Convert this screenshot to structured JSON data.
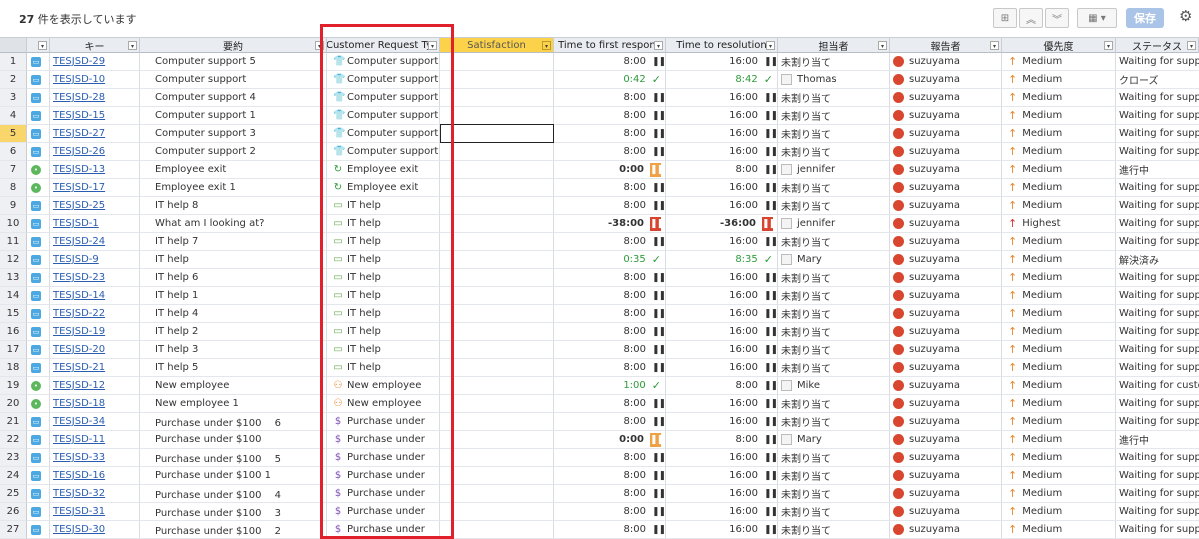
{
  "toolbar": {
    "count_number": "27",
    "count_suffix": " 件を表示しています",
    "save_label": "保存",
    "hierarchy_icon": "hierarchy-icon",
    "columns_icon": "columns-icon"
  },
  "columns": [
    {
      "label": "",
      "name": "col-rownum"
    },
    {
      "label": "",
      "name": "col-type"
    },
    {
      "label": "キー",
      "name": "col-key"
    },
    {
      "label": "要約",
      "name": "col-summary"
    },
    {
      "label": "Customer Request Ty",
      "name": "col-request-type"
    },
    {
      "label": "Satisfaction",
      "name": "col-satisfaction"
    },
    {
      "label": "Time to first respons",
      "name": "col-first-response"
    },
    {
      "label": "Time to resolution",
      "name": "col-resolution"
    },
    {
      "label": "担当者",
      "name": "col-assignee"
    },
    {
      "label": "報告者",
      "name": "col-reporter"
    },
    {
      "label": "優先度",
      "name": "col-priority"
    },
    {
      "label": "ステータス",
      "name": "col-status"
    }
  ],
  "rows": [
    {
      "n": "1",
      "t": "blue",
      "key": "TESJSD-29",
      "summary": "Computer support 5",
      "rtype": "Computer support",
      "ri": "shirt",
      "sat": "",
      "fr": "8:00",
      "frs": "pause",
      "res": "16:00",
      "ress": "pause",
      "asg": "未割り当て",
      "av": "none",
      "rep": "suzuyama",
      "pri": "Medium",
      "pa": "orange",
      "status": "Waiting for suppo"
    },
    {
      "n": "2",
      "t": "blue",
      "key": "TESJSD-10",
      "summary": "Computer support",
      "rtype": "Computer support",
      "ri": "shirt",
      "sat": "",
      "fr": "0:42",
      "frs": "check",
      "res": "8:42",
      "ress": "check",
      "asg": "Thomas",
      "av": "gray",
      "rep": "suzuyama",
      "pri": "Medium",
      "pa": "orange",
      "status": "クローズ"
    },
    {
      "n": "3",
      "t": "blue",
      "key": "TESJSD-28",
      "summary": "Computer support 4",
      "rtype": "Computer support",
      "ri": "shirt",
      "sat": "",
      "fr": "8:00",
      "frs": "pause",
      "res": "16:00",
      "ress": "pause",
      "asg": "未割り当て",
      "av": "none",
      "rep": "suzuyama",
      "pri": "Medium",
      "pa": "orange",
      "status": "Waiting for suppo"
    },
    {
      "n": "4",
      "t": "blue",
      "key": "TESJSD-15",
      "summary": "Computer support 1",
      "rtype": "Computer support",
      "ri": "shirt",
      "sat": "",
      "fr": "8:00",
      "frs": "pause",
      "res": "16:00",
      "ress": "pause",
      "asg": "未割り当て",
      "av": "none",
      "rep": "suzuyama",
      "pri": "Medium",
      "pa": "orange",
      "status": "Waiting for suppo"
    },
    {
      "n": "5",
      "t": "blue",
      "key": "TESJSD-27",
      "summary": "Computer support 3",
      "rtype": "Computer support",
      "ri": "shirt",
      "sat": "",
      "fr": "8:00",
      "frs": "pause",
      "res": "16:00",
      "ress": "pause",
      "asg": "未割り当て",
      "av": "none",
      "rep": "suzuyama",
      "pri": "Medium",
      "pa": "orange",
      "status": "Waiting for suppo"
    },
    {
      "n": "6",
      "t": "blue",
      "key": "TESJSD-26",
      "summary": "Computer support 2",
      "rtype": "Computer support",
      "ri": "shirt",
      "sat": "",
      "fr": "8:00",
      "frs": "pause",
      "res": "16:00",
      "ress": "pause",
      "asg": "未割り当て",
      "av": "none",
      "rep": "suzuyama",
      "pri": "Medium",
      "pa": "orange",
      "status": "Waiting for suppo"
    },
    {
      "n": "7",
      "t": "green",
      "key": "TESJSD-13",
      "summary": "Employee exit",
      "rtype": "Employee exit",
      "ri": "cycle",
      "sat": "",
      "fr": "0:00",
      "frs": "orange",
      "res": "8:00",
      "ress": "pause",
      "asg": "jennifer",
      "av": "gray",
      "rep": "suzuyama",
      "pri": "Medium",
      "pa": "orange",
      "status": "進行中"
    },
    {
      "n": "8",
      "t": "green",
      "key": "TESJSD-17",
      "summary": "Employee exit 1",
      "rtype": "Employee exit",
      "ri": "cycle",
      "sat": "",
      "fr": "8:00",
      "frs": "pause",
      "res": "16:00",
      "ress": "pause",
      "asg": "未割り当て",
      "av": "none",
      "rep": "suzuyama",
      "pri": "Medium",
      "pa": "orange",
      "status": "Waiting for suppo"
    },
    {
      "n": "9",
      "t": "blue",
      "key": "TESJSD-25",
      "summary": "IT help 8",
      "rtype": "IT help",
      "ri": "it",
      "sat": "",
      "fr": "8:00",
      "frs": "pause",
      "res": "16:00",
      "ress": "pause",
      "asg": "未割り当て",
      "av": "none",
      "rep": "suzuyama",
      "pri": "Medium",
      "pa": "orange",
      "status": "Waiting for suppo"
    },
    {
      "n": "10",
      "t": "blue",
      "key": "TESJSD-1",
      "summary": "What am I looking at?",
      "rtype": "IT help",
      "ri": "it",
      "sat": "",
      "fr": "-38:00",
      "frs": "red",
      "res": "-36:00",
      "ress": "red",
      "asg": "jennifer",
      "av": "gray",
      "rep": "suzuyama",
      "pri": "Highest",
      "pa": "red",
      "status": "Waiting for suppo"
    },
    {
      "n": "11",
      "t": "blue",
      "key": "TESJSD-24",
      "summary": "IT help 7",
      "rtype": "IT help",
      "ri": "it",
      "sat": "",
      "fr": "8:00",
      "frs": "pause",
      "res": "16:00",
      "ress": "pause",
      "asg": "未割り当て",
      "av": "none",
      "rep": "suzuyama",
      "pri": "Medium",
      "pa": "orange",
      "status": "Waiting for suppo"
    },
    {
      "n": "12",
      "t": "blue",
      "key": "TESJSD-9",
      "summary": "IT help",
      "rtype": "IT help",
      "ri": "it",
      "sat": "",
      "fr": "0:35",
      "frs": "check",
      "res": "8:35",
      "ress": "check",
      "asg": "Mary",
      "av": "gray",
      "rep": "suzuyama",
      "pri": "Medium",
      "pa": "orange",
      "status": "解決済み"
    },
    {
      "n": "13",
      "t": "blue",
      "key": "TESJSD-23",
      "summary": "IT help 6",
      "rtype": "IT help",
      "ri": "it",
      "sat": "",
      "fr": "8:00",
      "frs": "pause",
      "res": "16:00",
      "ress": "pause",
      "asg": "未割り当て",
      "av": "none",
      "rep": "suzuyama",
      "pri": "Medium",
      "pa": "orange",
      "status": "Waiting for suppo"
    },
    {
      "n": "14",
      "t": "blue",
      "key": "TESJSD-14",
      "summary": "IT help 1",
      "rtype": "IT help",
      "ri": "it",
      "sat": "",
      "fr": "8:00",
      "frs": "pause",
      "res": "16:00",
      "ress": "pause",
      "asg": "未割り当て",
      "av": "none",
      "rep": "suzuyama",
      "pri": "Medium",
      "pa": "orange",
      "status": "Waiting for suppo"
    },
    {
      "n": "15",
      "t": "blue",
      "key": "TESJSD-22",
      "summary": "IT help 4",
      "rtype": "IT help",
      "ri": "it",
      "sat": "",
      "fr": "8:00",
      "frs": "pause",
      "res": "16:00",
      "ress": "pause",
      "asg": "未割り当て",
      "av": "none",
      "rep": "suzuyama",
      "pri": "Medium",
      "pa": "orange",
      "status": "Waiting for suppo"
    },
    {
      "n": "16",
      "t": "blue",
      "key": "TESJSD-19",
      "summary": "IT help 2",
      "rtype": "IT help",
      "ri": "it",
      "sat": "",
      "fr": "8:00",
      "frs": "pause",
      "res": "16:00",
      "ress": "pause",
      "asg": "未割り当て",
      "av": "none",
      "rep": "suzuyama",
      "pri": "Medium",
      "pa": "orange",
      "status": "Waiting for suppo"
    },
    {
      "n": "17",
      "t": "blue",
      "key": "TESJSD-20",
      "summary": "IT help 3",
      "rtype": "IT help",
      "ri": "it",
      "sat": "",
      "fr": "8:00",
      "frs": "pause",
      "res": "16:00",
      "ress": "pause",
      "asg": "未割り当て",
      "av": "none",
      "rep": "suzuyama",
      "pri": "Medium",
      "pa": "orange",
      "status": "Waiting for suppo"
    },
    {
      "n": "18",
      "t": "blue",
      "key": "TESJSD-21",
      "summary": "IT help 5",
      "rtype": "IT help",
      "ri": "it",
      "sat": "",
      "fr": "8:00",
      "frs": "pause",
      "res": "16:00",
      "ress": "pause",
      "asg": "未割り当て",
      "av": "none",
      "rep": "suzuyama",
      "pri": "Medium",
      "pa": "orange",
      "status": "Waiting for suppo"
    },
    {
      "n": "19",
      "t": "green",
      "key": "TESJSD-12",
      "summary": "New employee",
      "rtype": "New employee",
      "ri": "person",
      "sat": "",
      "fr": "1:00",
      "frs": "check",
      "res": "8:00",
      "ress": "pause",
      "asg": "Mike",
      "av": "gray",
      "rep": "suzuyama",
      "pri": "Medium",
      "pa": "orange",
      "status": "Waiting for custo"
    },
    {
      "n": "20",
      "t": "green",
      "key": "TESJSD-18",
      "summary": "New employee 1",
      "rtype": "New employee",
      "ri": "person",
      "sat": "",
      "fr": "8:00",
      "frs": "pause",
      "res": "16:00",
      "ress": "pause",
      "asg": "未割り当て",
      "av": "none",
      "rep": "suzuyama",
      "pri": "Medium",
      "pa": "orange",
      "status": "Waiting for suppo"
    },
    {
      "n": "21",
      "t": "blue",
      "key": "TESJSD-34",
      "summary": "Purchase under $100　 6",
      "rtype": "Purchase under",
      "ri": "dollar",
      "sat": "",
      "fr": "8:00",
      "frs": "pause",
      "res": "16:00",
      "ress": "pause",
      "asg": "未割り当て",
      "av": "none",
      "rep": "suzuyama",
      "pri": "Medium",
      "pa": "orange",
      "status": "Waiting for suppo"
    },
    {
      "n": "22",
      "t": "blue",
      "key": "TESJSD-11",
      "summary": "Purchase under $100",
      "rtype": "Purchase under",
      "ri": "dollar",
      "sat": "",
      "fr": "0:00",
      "frs": "orange",
      "res": "8:00",
      "ress": "pause",
      "asg": "Mary",
      "av": "gray",
      "rep": "suzuyama",
      "pri": "Medium",
      "pa": "orange",
      "status": "進行中"
    },
    {
      "n": "23",
      "t": "blue",
      "key": "TESJSD-33",
      "summary": "Purchase under $100　 5",
      "rtype": "Purchase under",
      "ri": "dollar",
      "sat": "",
      "fr": "8:00",
      "frs": "pause",
      "res": "16:00",
      "ress": "pause",
      "asg": "未割り当て",
      "av": "none",
      "rep": "suzuyama",
      "pri": "Medium",
      "pa": "orange",
      "status": "Waiting for suppo"
    },
    {
      "n": "24",
      "t": "blue",
      "key": "TESJSD-16",
      "summary": "Purchase under $100 1",
      "rtype": "Purchase under",
      "ri": "dollar",
      "sat": "",
      "fr": "8:00",
      "frs": "pause",
      "res": "16:00",
      "ress": "pause",
      "asg": "未割り当て",
      "av": "none",
      "rep": "suzuyama",
      "pri": "Medium",
      "pa": "orange",
      "status": "Waiting for suppo"
    },
    {
      "n": "25",
      "t": "blue",
      "key": "TESJSD-32",
      "summary": "Purchase under $100　 4",
      "rtype": "Purchase under",
      "ri": "dollar",
      "sat": "",
      "fr": "8:00",
      "frs": "pause",
      "res": "16:00",
      "ress": "pause",
      "asg": "未割り当て",
      "av": "none",
      "rep": "suzuyama",
      "pri": "Medium",
      "pa": "orange",
      "status": "Waiting for suppo"
    },
    {
      "n": "26",
      "t": "blue",
      "key": "TESJSD-31",
      "summary": "Purchase under $100　 3",
      "rtype": "Purchase under",
      "ri": "dollar",
      "sat": "",
      "fr": "8:00",
      "frs": "pause",
      "res": "16:00",
      "ress": "pause",
      "asg": "未割り当て",
      "av": "none",
      "rep": "suzuyama",
      "pri": "Medium",
      "pa": "orange",
      "status": "Waiting for suppo"
    },
    {
      "n": "27",
      "t": "blue",
      "key": "TESJSD-30",
      "summary": "Purchase under $100　 2",
      "rtype": "Purchase under",
      "ri": "dollar",
      "sat": "",
      "fr": "8:00",
      "frs": "pause",
      "res": "16:00",
      "ress": "pause",
      "asg": "未割り当て",
      "av": "none",
      "rep": "suzuyama",
      "pri": "Medium",
      "pa": "orange",
      "status": "Waiting for suppo"
    }
  ],
  "selected_row": "5",
  "colors": {
    "accent": "#2a5db0",
    "highlight_box": "#e0202a",
    "satisfaction_header": "#fbd24a",
    "save_button": "#a9c4e6"
  }
}
